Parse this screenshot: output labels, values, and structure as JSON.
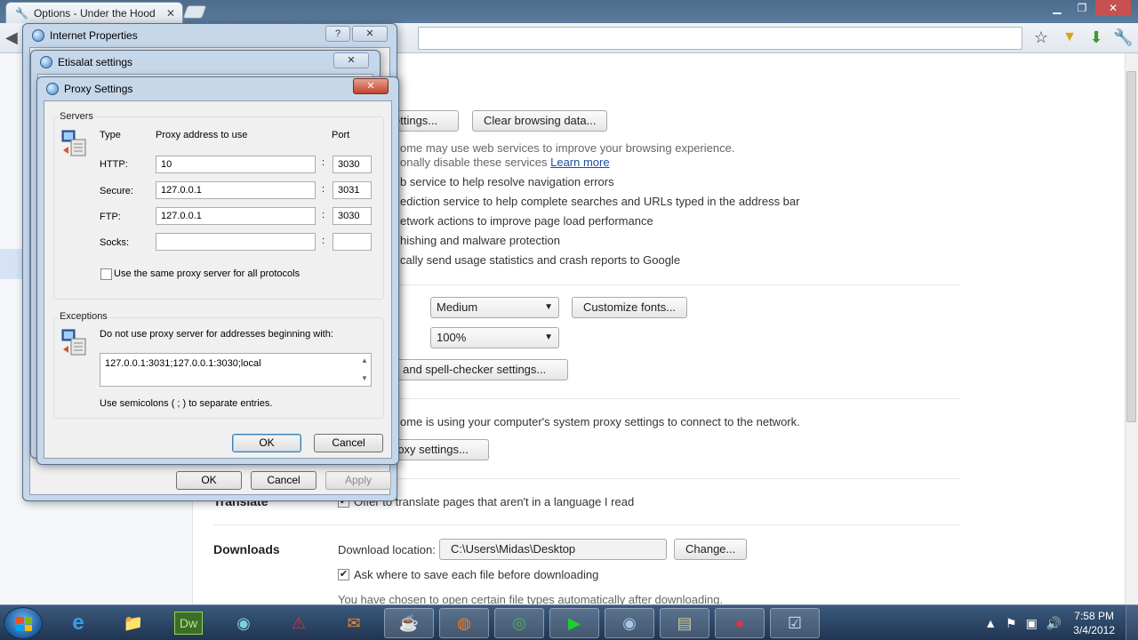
{
  "browser": {
    "tab_title": "Options - Under the Hood",
    "tab_close": "✕"
  },
  "settings": {
    "content_settings_partial": "ettings...",
    "clear_browsing_data": "Clear browsing data...",
    "privacy_desc_1": "ome may use web services to improve your browsing experience.",
    "privacy_desc_2": "onally disable these services",
    "learn_more": "Learn more",
    "opt_nav_errors": "b service to help resolve navigation errors",
    "opt_prediction": "ediction service to help complete searches and URLs typed in the address bar",
    "opt_network": "etwork actions to improve page load performance",
    "opt_phishing": "hishing and malware protection",
    "opt_usage": "cally send usage statistics and crash reports to Google",
    "font_size_value": "Medium",
    "customize_fonts": "Customize fonts...",
    "zoom_value": "100%",
    "spellcheck_partial": "s and spell-checker settings...",
    "network_desc": "ome is using your computer's system proxy settings to connect to the network.",
    "proxy_partial": "roxy settings...",
    "translate_heading": "Translate",
    "translate_option": "Offer to translate pages that aren't in a language I read",
    "downloads_heading": "Downloads",
    "download_location_label": "Download location:",
    "download_location_value": "C:\\Users\\Midas\\Desktop",
    "change_button": "Change...",
    "ask_where_to_save": "Ask where to save each file before downloading",
    "auto_open_note": "You have chosen to open certain file types automatically after downloading."
  },
  "internet_properties": {
    "title": "Internet Properties",
    "help": "?",
    "close": "✕",
    "ok": "OK",
    "cancel": "Cancel",
    "apply": "Apply"
  },
  "etisalat": {
    "title": "Etisalat settings",
    "close": "✕"
  },
  "proxy_settings": {
    "title": "Proxy Settings",
    "close": "✕",
    "servers_label": "Servers",
    "type_header": "Type",
    "address_header": "Proxy address to use",
    "port_header": "Port",
    "rows": [
      {
        "type": "HTTP:",
        "address": "10",
        "port": "3030"
      },
      {
        "type": "Secure:",
        "address": "127.0.0.1",
        "port": "3031"
      },
      {
        "type": "FTP:",
        "address": "127.0.0.1",
        "port": "3030"
      },
      {
        "type": "Socks:",
        "address": "",
        "port": ""
      }
    ],
    "colon": ":",
    "same_proxy": "Use the same proxy server for all protocols",
    "exceptions_label": "Exceptions",
    "do_not_use": "Do not use proxy server for addresses beginning with:",
    "exceptions_value": "127.0.0.1:3031;127.0.0.1:3030;local",
    "semicolons_note": "Use semicolons ( ; ) to separate entries.",
    "ok": "OK",
    "cancel": "Cancel"
  },
  "taskbar": {
    "time": "7:58 PM",
    "date": "3/4/2012",
    "dw_label": "Dw"
  }
}
